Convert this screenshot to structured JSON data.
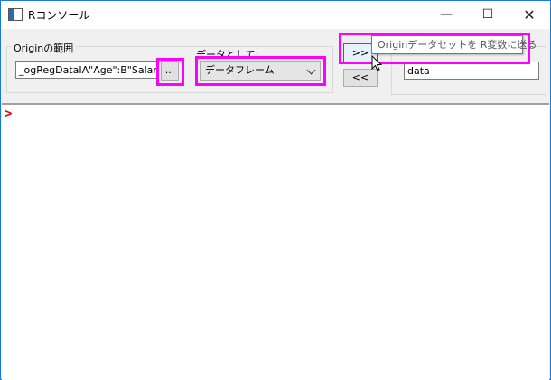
{
  "window": {
    "title": "Rコンソール",
    "minimize_glyph": "—",
    "maximize_glyph": "☐",
    "close_glyph": "✕"
  },
  "range_group": {
    "label": "Originの範囲",
    "value": "_ogRegDataIA\"Age\":B\"Salary\"",
    "browse_label": "..."
  },
  "as_group": {
    "label": "データとして:",
    "selected": "データフレーム"
  },
  "transfer": {
    "send_label": ">>",
    "receive_label": "<<",
    "tooltip": "Originデータセットを R変数に送る"
  },
  "rvar_group": {
    "value": "data"
  },
  "console": {
    "prompt": ">"
  },
  "colors": {
    "highlight": "#ff00ff",
    "prompt": "#e00000",
    "accent": "#0078d7"
  },
  "icons": [
    "app-window-icon",
    "chevron-down-icon",
    "mouse-pointer-icon"
  ]
}
